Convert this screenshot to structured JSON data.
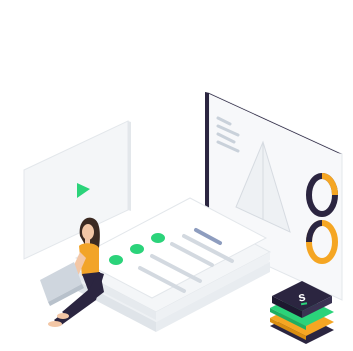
{
  "illustration": {
    "colors": {
      "background": "#ffffff",
      "panel": "#f4f6f8",
      "panel_edge": "#e3e7eb",
      "dark_edge": "#2b2540",
      "accent_green": "#2bd37a",
      "text_lines": "#c9d1da",
      "text_lines_blue": "#8e9dbf",
      "orange": "#f5a623",
      "ring_dark": "#2b2540",
      "person_hair": "#3b2a22",
      "person_shirt": "#f2a428",
      "person_pants": "#2b2540",
      "person_skin": "#f3c7a6",
      "laptop": "#cfd6de"
    },
    "icons": {
      "play": "play-icon",
      "logo_s": "s-logo-icon",
      "donut": "donut-chart-icon"
    }
  }
}
